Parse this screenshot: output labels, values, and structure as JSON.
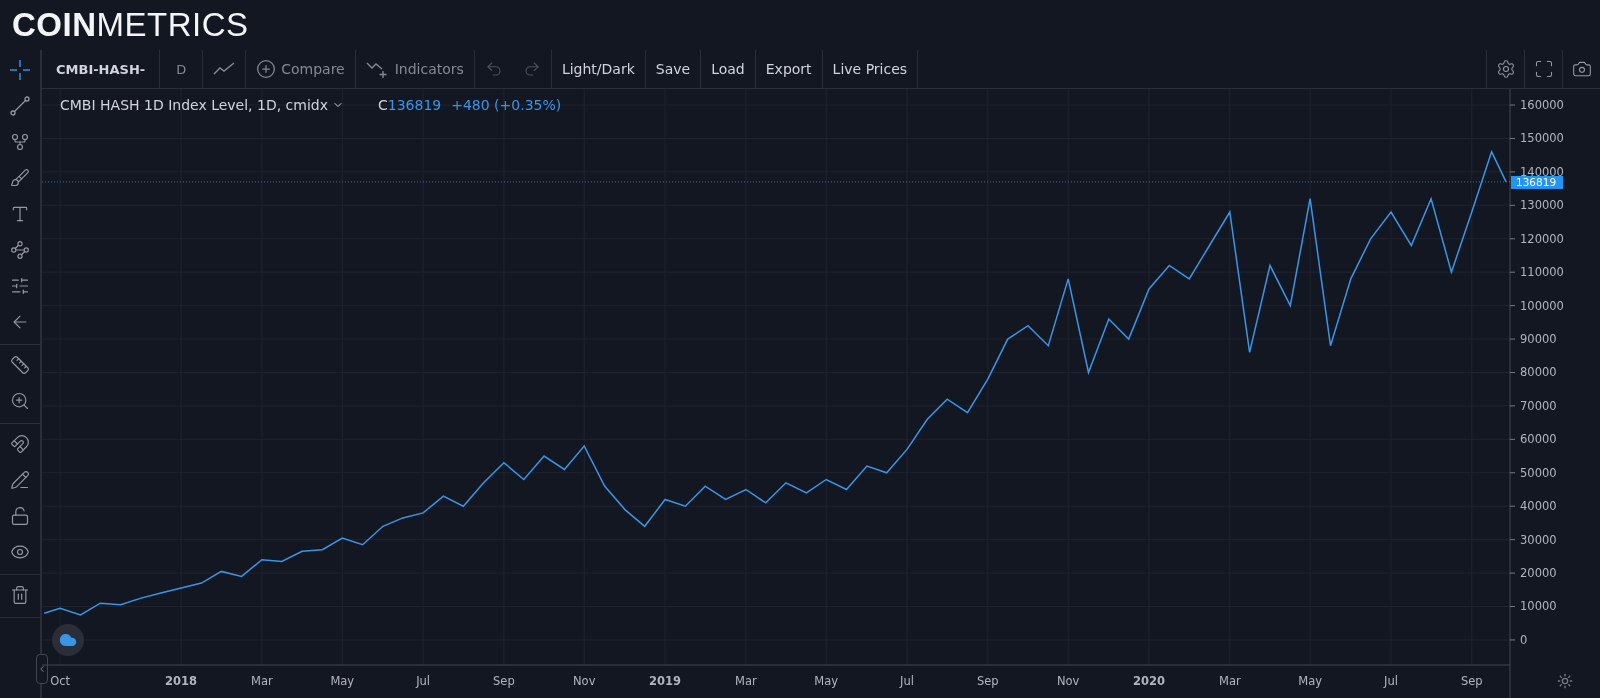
{
  "header": {
    "logo": "**COIN**METRICS"
  },
  "tool_groups": [
    [
      {
        "kind": "crosshair",
        "selected": true
      },
      {
        "kind": "trend-line",
        "selected": false
      },
      {
        "kind": "pitchfork",
        "selected": false
      },
      {
        "kind": "brush",
        "selected": false
      },
      {
        "kind": "text",
        "selected": false
      },
      {
        "kind": "pattern",
        "selected": false
      },
      {
        "kind": "prediction",
        "selected": false
      },
      {
        "kind": "back",
        "selected": false
      }
    ],
    [
      {
        "kind": "ruler",
        "selected": false
      },
      {
        "kind": "zoom",
        "selected": false
      }
    ],
    [
      {
        "kind": "magnet",
        "selected": false
      },
      {
        "kind": "pencil-lock",
        "selected": false
      },
      {
        "kind": "lock",
        "selected": false
      },
      {
        "kind": "eye",
        "selected": false
      }
    ],
    [
      {
        "kind": "trash",
        "selected": false
      }
    ]
  ],
  "toolbar": {
    "items": [
      {
        "kind": "symbol",
        "label": "CMBI-HASH-"
      },
      {
        "kind": "interval",
        "label": "D"
      },
      {
        "kind": "chart-type"
      },
      {
        "kind": "compare",
        "label": "Compare"
      },
      {
        "kind": "indicators",
        "label": "Indicators"
      },
      {
        "kind": "undo",
        "disabled": true
      },
      {
        "kind": "redo",
        "disabled": true
      },
      {
        "kind": "button",
        "label": "Light/Dark"
      },
      {
        "kind": "button",
        "label": "Save"
      },
      {
        "kind": "button",
        "label": "Load"
      },
      {
        "kind": "button",
        "label": "Export"
      },
      {
        "kind": "button",
        "label": "Live Prices"
      }
    ],
    "right": [
      {
        "kind": "settings"
      },
      {
        "kind": "fullscreen"
      },
      {
        "kind": "screenshot"
      }
    ]
  },
  "legend": {
    "title": "CMBI HASH 1D Index Level, 1D, cmidx",
    "close_label": "C",
    "close": "136819",
    "change": "+480 (+0.35%)"
  },
  "chart_data": {
    "type": "line",
    "x": [
      2017.717,
      2017.75,
      2017.792,
      2017.833,
      2017.875,
      2017.917,
      2017.958,
      2018.0,
      2018.042,
      2018.083,
      2018.125,
      2018.167,
      2018.208,
      2018.25,
      2018.292,
      2018.333,
      2018.375,
      2018.417,
      2018.458,
      2018.5,
      2018.542,
      2018.583,
      2018.625,
      2018.667,
      2018.708,
      2018.75,
      2018.792,
      2018.833,
      2018.875,
      2018.917,
      2018.958,
      2019.0,
      2019.042,
      2019.083,
      2019.125,
      2019.167,
      2019.208,
      2019.25,
      2019.292,
      2019.333,
      2019.375,
      2019.417,
      2019.458,
      2019.5,
      2019.542,
      2019.583,
      2019.625,
      2019.667,
      2019.708,
      2019.75,
      2019.792,
      2019.833,
      2019.875,
      2019.917,
      2019.958,
      2020.0,
      2020.042,
      2020.083,
      2020.125,
      2020.167,
      2020.208,
      2020.25,
      2020.292,
      2020.333,
      2020.375,
      2020.417,
      2020.458,
      2020.5,
      2020.542,
      2020.583,
      2020.625,
      2020.667,
      2020.708,
      2020.738
    ],
    "series": [
      {
        "color": "#3a95e6",
        "values": [
          8000,
          9500,
          7500,
          11000,
          10500,
          12500,
          14000,
          15500,
          17000,
          20500,
          19000,
          24000,
          23500,
          26500,
          27000,
          30500,
          28500,
          34000,
          36500,
          38000,
          43000,
          40000,
          47000,
          53000,
          48000,
          55000,
          51000,
          58000,
          46000,
          39000,
          34000,
          42000,
          40000,
          46000,
          42000,
          45000,
          41000,
          47000,
          44000,
          48000,
          45000,
          52000,
          50000,
          57000,
          66000,
          72000,
          68000,
          78000,
          90000,
          94000,
          88000,
          108000,
          80000,
          96000,
          90000,
          105000,
          112000,
          108000,
          118000,
          128000,
          86000,
          112000,
          100000,
          132000,
          88000,
          108000,
          120000,
          128000,
          118000,
          132000,
          110000,
          128000,
          146000,
          137000
        ]
      }
    ],
    "xlim": [
      2017.7125,
      2020.746
    ],
    "ylim": [
      -7500,
      164800
    ],
    "xticks": [
      {
        "value": 2017.75,
        "label": "Oct"
      },
      {
        "value": 2018,
        "label": "2018"
      },
      {
        "value": 2018.167,
        "label": "Mar"
      },
      {
        "value": 2018.333,
        "label": "May"
      },
      {
        "value": 2018.5,
        "label": "Jul"
      },
      {
        "value": 2018.667,
        "label": "Sep"
      },
      {
        "value": 2018.833,
        "label": "Nov"
      },
      {
        "value": 2019,
        "label": "2019"
      },
      {
        "value": 2019.167,
        "label": "Mar"
      },
      {
        "value": 2019.333,
        "label": "May"
      },
      {
        "value": 2019.5,
        "label": "Jul"
      },
      {
        "value": 2019.667,
        "label": "Sep"
      },
      {
        "value": 2019.833,
        "label": "Nov"
      },
      {
        "value": 2020,
        "label": "2020"
      },
      {
        "value": 2020.167,
        "label": "Mar"
      },
      {
        "value": 2020.333,
        "label": "May"
      },
      {
        "value": 2020.5,
        "label": "Jul"
      },
      {
        "value": 2020.667,
        "label": "Sep"
      }
    ],
    "yticks": [
      0,
      10000,
      20000,
      30000,
      40000,
      50000,
      60000,
      70000,
      80000,
      90000,
      100000,
      110000,
      120000,
      130000,
      140000,
      150000,
      160000
    ],
    "grid": true,
    "ref_lines": [
      {
        "axis": "y",
        "value": 137000
      }
    ],
    "annotations": [
      "136819"
    ]
  }
}
